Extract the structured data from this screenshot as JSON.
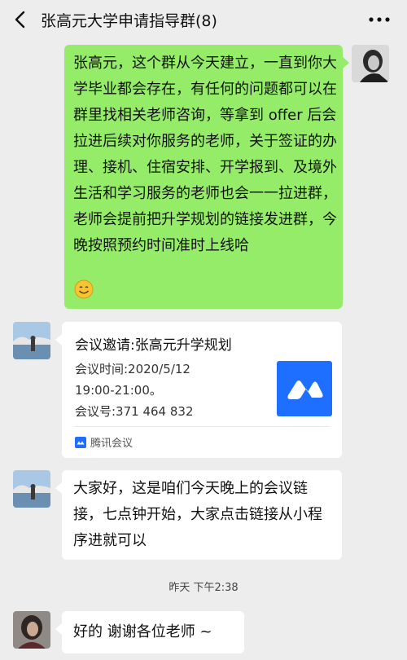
{
  "header": {
    "title": "张高元大学申请指导群(8)",
    "back_icon": "chevron-left-icon",
    "more_icon": "more-dots-icon"
  },
  "messages": [
    {
      "id": "m1",
      "side": "right",
      "text": "张高元，这个群从今天建立，一直到你大学毕业都会存在，有任何的问题都可以在群里找相关老师咨询，等拿到 offer 后会拉进后续对你服务的老师，关于签证的办理、接机、住宿安排、开学报到、及境外生活和学习服务的老师也会一一拉进群，老师会提前把升学规划的链接发进群，今晚按照预约时间准时上线哈",
      "emoji": "smile-emoji-icon"
    },
    {
      "id": "m2",
      "side": "left",
      "card": {
        "title": "会议邀请:张高元升学规划",
        "time_label": "会议时间:2020/5/12",
        "time_range": "19:00-21:00。",
        "meeting_id": "会议号:371 464 832",
        "source": "腾讯会议"
      }
    },
    {
      "id": "m3",
      "side": "left",
      "text": "大家好，这是咱们今天晚上的会议链接，七点钟开始，大家点击链接从小程序进就可以"
    },
    {
      "id": "m4",
      "side": "left",
      "text": "好的 谢谢各位老师 ~"
    }
  ],
  "timestamp": "昨天 下午2:38",
  "colors": {
    "background": "#ededed",
    "green_bubble": "#95ec69",
    "white_bubble": "#ffffff",
    "tencent_blue": "#1e6fff"
  }
}
